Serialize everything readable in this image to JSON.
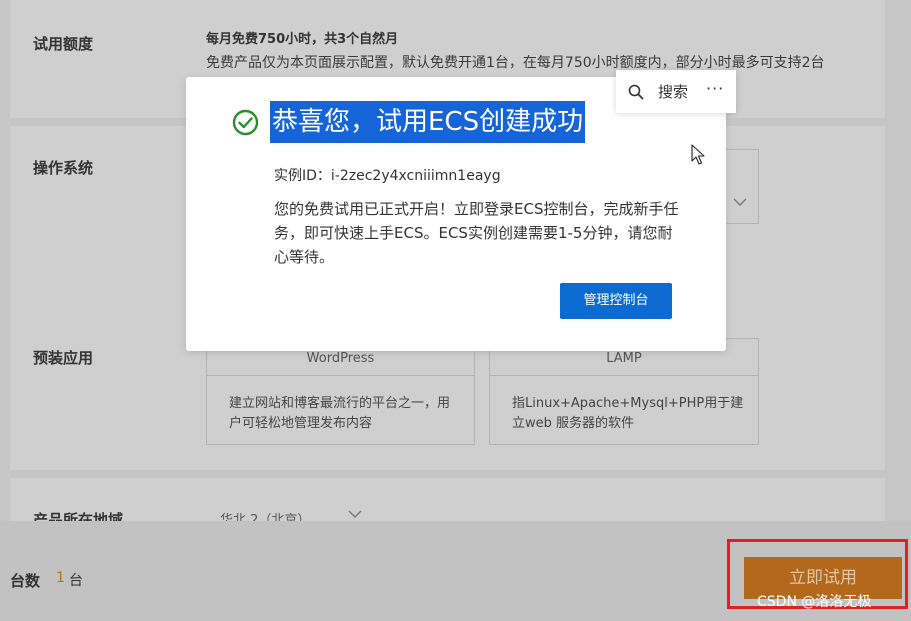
{
  "sections": {
    "trial_quota": {
      "label": "试用额度",
      "title": "每月免费750小时，共3个自然月",
      "description": "免费产品仅为本页面展示配置，默认免费开通1台，在每月750小时额度内，部分小时最多可支持2台"
    },
    "os": {
      "label": "操作系统"
    },
    "preinstalled_apps": {
      "label": "预装应用",
      "apps": [
        {
          "name": "WordPress",
          "description": "建立网站和博客最流行的平台之一，用户可轻松地管理发布内容"
        },
        {
          "name": "LAMP",
          "description": "指Linux+Apache+Mysql+PHP用于建立web 服务器的软件"
        }
      ]
    },
    "region": {
      "label": "产品所在地域",
      "value": "华北 2（北京）"
    }
  },
  "bottom_bar": {
    "count_label": "台数",
    "count_value": "1",
    "count_unit": "台",
    "try_button": "立即试用"
  },
  "modal": {
    "title": "恭喜您，试用ECS创建成功",
    "instance_id": "实例ID：i-2zec2y4xcniiimn1eayg",
    "body": "您的免费试用已正式开启！立即登录ECS控制台，完成新手任务，即可快速上手ECS。ECS实例创建需要1-5分钟，请您耐心等待。",
    "manage_button": "管理控制台"
  },
  "search_popup": {
    "label": "搜索",
    "more": "···"
  },
  "watermark": "CSDN @洛洛无极",
  "colors": {
    "modal_accent": "#1565d8",
    "success_green": "#2e8b2e",
    "primary_button": "#0b6bd1",
    "try_button": "#b3681b",
    "highlight_border": "#e32020"
  },
  "icons": [
    "check-circle-icon",
    "search-icon",
    "more-icon",
    "chevron-down-icon",
    "cursor-icon"
  ]
}
